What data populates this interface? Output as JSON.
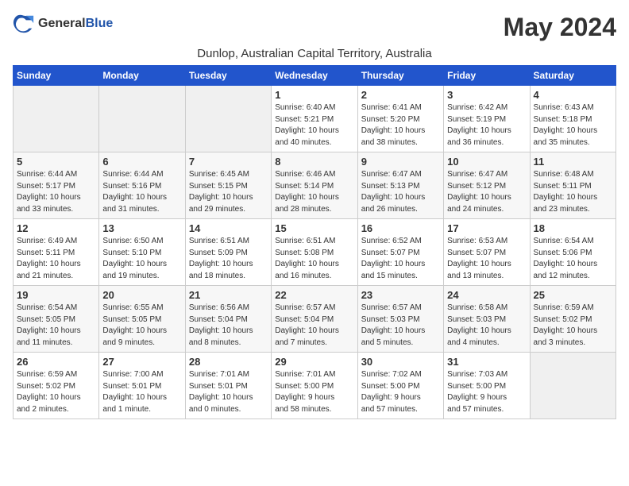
{
  "logo": {
    "general": "General",
    "blue": "Blue"
  },
  "title": "May 2024",
  "subtitle": "Dunlop, Australian Capital Territory, Australia",
  "days_of_week": [
    "Sunday",
    "Monday",
    "Tuesday",
    "Wednesday",
    "Thursday",
    "Friday",
    "Saturday"
  ],
  "weeks": [
    [
      {
        "day": "",
        "info": ""
      },
      {
        "day": "",
        "info": ""
      },
      {
        "day": "",
        "info": ""
      },
      {
        "day": "1",
        "info": "Sunrise: 6:40 AM\nSunset: 5:21 PM\nDaylight: 10 hours\nand 40 minutes."
      },
      {
        "day": "2",
        "info": "Sunrise: 6:41 AM\nSunset: 5:20 PM\nDaylight: 10 hours\nand 38 minutes."
      },
      {
        "day": "3",
        "info": "Sunrise: 6:42 AM\nSunset: 5:19 PM\nDaylight: 10 hours\nand 36 minutes."
      },
      {
        "day": "4",
        "info": "Sunrise: 6:43 AM\nSunset: 5:18 PM\nDaylight: 10 hours\nand 35 minutes."
      }
    ],
    [
      {
        "day": "5",
        "info": "Sunrise: 6:44 AM\nSunset: 5:17 PM\nDaylight: 10 hours\nand 33 minutes."
      },
      {
        "day": "6",
        "info": "Sunrise: 6:44 AM\nSunset: 5:16 PM\nDaylight: 10 hours\nand 31 minutes."
      },
      {
        "day": "7",
        "info": "Sunrise: 6:45 AM\nSunset: 5:15 PM\nDaylight: 10 hours\nand 29 minutes."
      },
      {
        "day": "8",
        "info": "Sunrise: 6:46 AM\nSunset: 5:14 PM\nDaylight: 10 hours\nand 28 minutes."
      },
      {
        "day": "9",
        "info": "Sunrise: 6:47 AM\nSunset: 5:13 PM\nDaylight: 10 hours\nand 26 minutes."
      },
      {
        "day": "10",
        "info": "Sunrise: 6:47 AM\nSunset: 5:12 PM\nDaylight: 10 hours\nand 24 minutes."
      },
      {
        "day": "11",
        "info": "Sunrise: 6:48 AM\nSunset: 5:11 PM\nDaylight: 10 hours\nand 23 minutes."
      }
    ],
    [
      {
        "day": "12",
        "info": "Sunrise: 6:49 AM\nSunset: 5:11 PM\nDaylight: 10 hours\nand 21 minutes."
      },
      {
        "day": "13",
        "info": "Sunrise: 6:50 AM\nSunset: 5:10 PM\nDaylight: 10 hours\nand 19 minutes."
      },
      {
        "day": "14",
        "info": "Sunrise: 6:51 AM\nSunset: 5:09 PM\nDaylight: 10 hours\nand 18 minutes."
      },
      {
        "day": "15",
        "info": "Sunrise: 6:51 AM\nSunset: 5:08 PM\nDaylight: 10 hours\nand 16 minutes."
      },
      {
        "day": "16",
        "info": "Sunrise: 6:52 AM\nSunset: 5:07 PM\nDaylight: 10 hours\nand 15 minutes."
      },
      {
        "day": "17",
        "info": "Sunrise: 6:53 AM\nSunset: 5:07 PM\nDaylight: 10 hours\nand 13 minutes."
      },
      {
        "day": "18",
        "info": "Sunrise: 6:54 AM\nSunset: 5:06 PM\nDaylight: 10 hours\nand 12 minutes."
      }
    ],
    [
      {
        "day": "19",
        "info": "Sunrise: 6:54 AM\nSunset: 5:05 PM\nDaylight: 10 hours\nand 11 minutes."
      },
      {
        "day": "20",
        "info": "Sunrise: 6:55 AM\nSunset: 5:05 PM\nDaylight: 10 hours\nand 9 minutes."
      },
      {
        "day": "21",
        "info": "Sunrise: 6:56 AM\nSunset: 5:04 PM\nDaylight: 10 hours\nand 8 minutes."
      },
      {
        "day": "22",
        "info": "Sunrise: 6:57 AM\nSunset: 5:04 PM\nDaylight: 10 hours\nand 7 minutes."
      },
      {
        "day": "23",
        "info": "Sunrise: 6:57 AM\nSunset: 5:03 PM\nDaylight: 10 hours\nand 5 minutes."
      },
      {
        "day": "24",
        "info": "Sunrise: 6:58 AM\nSunset: 5:03 PM\nDaylight: 10 hours\nand 4 minutes."
      },
      {
        "day": "25",
        "info": "Sunrise: 6:59 AM\nSunset: 5:02 PM\nDaylight: 10 hours\nand 3 minutes."
      }
    ],
    [
      {
        "day": "26",
        "info": "Sunrise: 6:59 AM\nSunset: 5:02 PM\nDaylight: 10 hours\nand 2 minutes."
      },
      {
        "day": "27",
        "info": "Sunrise: 7:00 AM\nSunset: 5:01 PM\nDaylight: 10 hours\nand 1 minute."
      },
      {
        "day": "28",
        "info": "Sunrise: 7:01 AM\nSunset: 5:01 PM\nDaylight: 10 hours\nand 0 minutes."
      },
      {
        "day": "29",
        "info": "Sunrise: 7:01 AM\nSunset: 5:00 PM\nDaylight: 9 hours\nand 58 minutes."
      },
      {
        "day": "30",
        "info": "Sunrise: 7:02 AM\nSunset: 5:00 PM\nDaylight: 9 hours\nand 57 minutes."
      },
      {
        "day": "31",
        "info": "Sunrise: 7:03 AM\nSunset: 5:00 PM\nDaylight: 9 hours\nand 57 minutes."
      },
      {
        "day": "",
        "info": ""
      }
    ]
  ]
}
